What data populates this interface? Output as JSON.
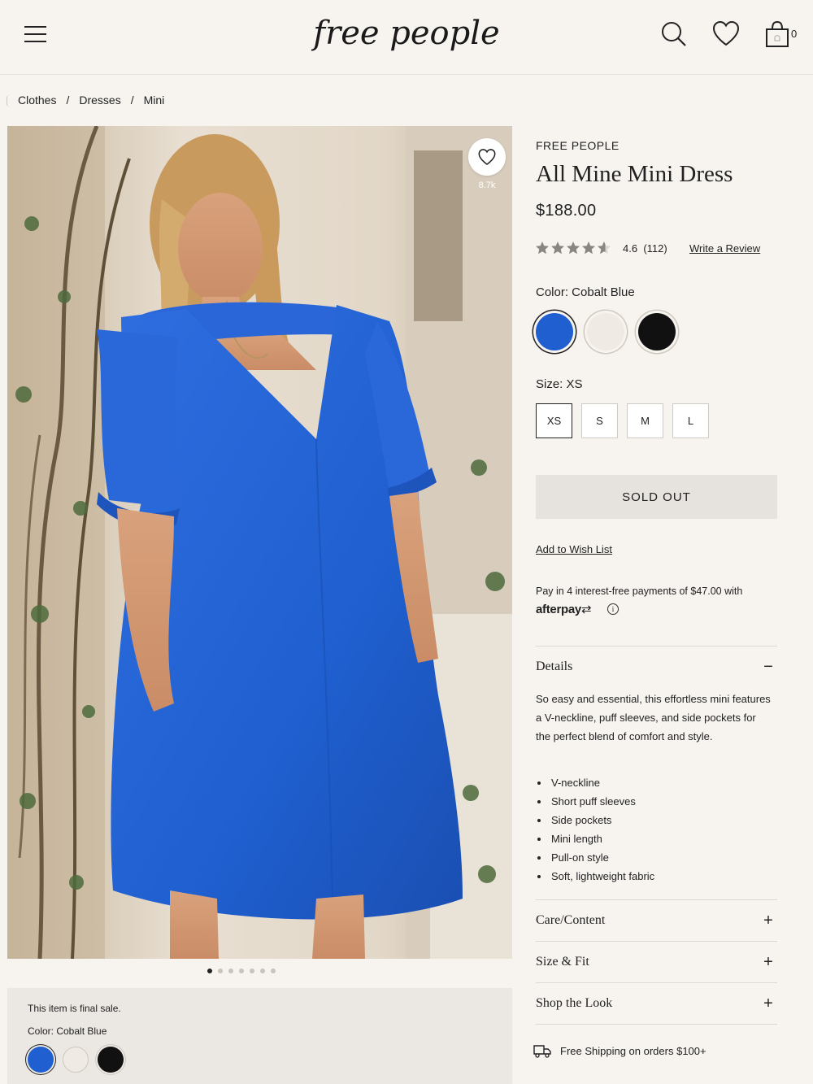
{
  "header": {
    "logo_text": "free people",
    "cart_count": "0"
  },
  "breadcrumb": [
    "Clothes",
    "Dresses",
    "Mini"
  ],
  "gallery": {
    "favorites_count": "8.7k",
    "dots_total": 7,
    "dot_active": 0
  },
  "product": {
    "brand": "FREE PEOPLE",
    "title": "All Mine Mini Dress",
    "price": "$188.00",
    "rating_value": 4.6,
    "rating_text": "4.6",
    "review_count": "(112)",
    "write_review": "Write a Review",
    "color_label": "Color: Cobalt Blue",
    "colors": [
      {
        "name": "Cobalt Blue",
        "hex": "#1f5fcf",
        "selected": true
      },
      {
        "name": "Ivory",
        "hex": "#efebe4",
        "selected": false
      },
      {
        "name": "Black",
        "hex": "#111111",
        "selected": false
      }
    ],
    "size_label": "Size: XS",
    "sizes": [
      "XS",
      "S",
      "M",
      "L"
    ],
    "selected_size": "XS",
    "sold_out": "SOLD OUT",
    "add_wishlist": "Add to Wish List",
    "afterpay_text": "Pay in 4 interest-free payments of $47.00 with",
    "afterpay_brand": "afterpay"
  },
  "details": {
    "title": "Details",
    "toggle": "−",
    "description": "So easy and essential, this effortless mini features a V-neckline, puff sleeves, and side pockets for the perfect blend of comfort and style.",
    "features": [
      "V-neckline",
      "Short puff sleeves",
      "Side pockets",
      "Mini length",
      "Pull-on style",
      "Soft, lightweight fabric"
    ]
  },
  "accordions": [
    {
      "title": "Care/Content",
      "toggle": "+"
    },
    {
      "title": "Size & Fit",
      "toggle": "+"
    },
    {
      "title": "Shop the Look",
      "toggle": "+"
    }
  ],
  "final_sale": {
    "text": "This item is final sale.",
    "color_label": "Color: Cobalt Blue"
  },
  "shipping": "Free Shipping on orders $100+",
  "colors": {
    "background": "#f7f4f0",
    "accent_blue": "#1f5fcf",
    "button_gray": "#e6e2dd"
  }
}
